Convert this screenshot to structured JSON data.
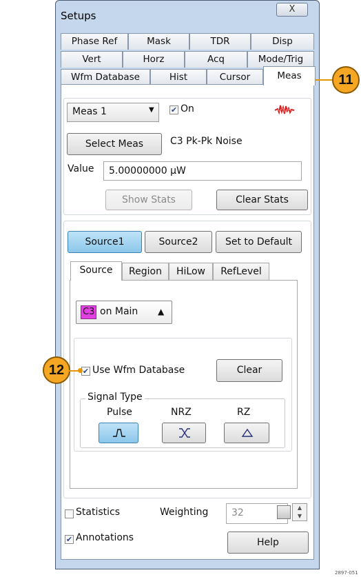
{
  "window": {
    "title": "Setups",
    "close_label": "X"
  },
  "tabs": {
    "row1": [
      "Phase Ref",
      "Mask",
      "TDR",
      "Disp"
    ],
    "row2": [
      "Vert",
      "Horz",
      "Acq",
      "Mode/Trig"
    ],
    "row3": [
      "Wfm Database",
      "Hist",
      "Cursor",
      "Meas"
    ],
    "active": "Meas"
  },
  "meas": {
    "selected": "Meas 1",
    "on_label": "On",
    "on_checked": true,
    "select_button": "Select Meas",
    "description": "C3 Pk-Pk Noise",
    "value_label": "Value",
    "value": "5.00000000 µW",
    "show_stats": "Show Stats",
    "clear_stats": "Clear Stats"
  },
  "source_buttons": {
    "source1": "Source1",
    "source2": "Source2",
    "default": "Set to Default",
    "active": "Source1"
  },
  "inner_tabs": {
    "items": [
      "Source",
      "Region",
      "HiLow",
      "RefLevel"
    ],
    "active": "Source"
  },
  "source": {
    "channel_badge": "C3",
    "channel_text": "on Main",
    "channel_color": "#e040e0",
    "use_wfm_db": "Use Wfm Database",
    "use_wfm_db_checked": true,
    "clear": "Clear",
    "signal_type_label": "Signal Type",
    "signal_types": [
      "Pulse",
      "NRZ",
      "RZ"
    ],
    "selected_signal": "Pulse"
  },
  "footer": {
    "statistics": "Statistics",
    "statistics_checked": false,
    "weighting_label": "Weighting",
    "weighting_value": "32",
    "annotations": "Annotations",
    "annotations_checked": true,
    "help": "Help"
  },
  "callouts": [
    "11",
    "12"
  ],
  "figure_id": "2897-051"
}
